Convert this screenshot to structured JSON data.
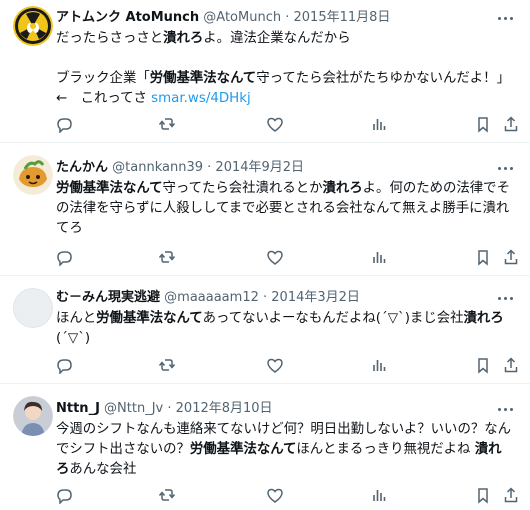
{
  "tweets": [
    {
      "display_name": "アトムンク AtoMunch",
      "handle": "@AtoMunch",
      "separator": "·",
      "date": "2015年11月8日",
      "line1_a": "だったらさっさと",
      "line1_b": "潰れろ",
      "line1_c": "よ。違法企業なんだから",
      "line2_a": "ブラック企業「",
      "line2_b": "労働基準法なんて",
      "line2_c": "守ってたら会社がたちゆかないんだよ！」",
      "line3_a": "←　これってさ ",
      "line3_link": "smar.ws/4DHkj"
    },
    {
      "display_name": "たんかん",
      "handle": "@tannkann39",
      "separator": "·",
      "date": "2014年9月2日",
      "line1_a": "労働基準法なんて",
      "line1_b": "守ってたら会社潰れるとか",
      "line1_c": "潰れろ",
      "line1_d": "よ。何のための法律でそ",
      "line2": "の法律を守らずに人殺ししてまで必要とされる会社なんて無えよ勝手に潰れ",
      "line3": "てろ"
    },
    {
      "display_name": "む－みん現実逃避",
      "handle": "@maaaaam12",
      "separator": "·",
      "date": "2014年3月2日",
      "line1_a": "ほんと",
      "line1_b": "労働基準法なんて",
      "line1_c": "あってないよーなもんだよね(´▽`)まじ会社",
      "line1_d": "潰れろ",
      "line2": "(´▽`)"
    },
    {
      "display_name": "Nttn_J",
      "handle": "@Nttn_Jv",
      "separator": "·",
      "date": "2012年8月10日",
      "line1": "今週のシフトなんも連絡来てないけど何？明日出勤しないよ？いいの？なん",
      "line2_a": "でシフト出さないの？",
      "line2_b": "労働基準法なんて",
      "line2_c": "ほんとまるっきり無視だよね ",
      "line2_d": "潰れ",
      "line3_a": "ろ",
      "line3_b": "あんな会社"
    }
  ],
  "colors": {
    "text": "#0f1419",
    "meta": "#536471",
    "link": "#1d9bf0",
    "divider": "#eff3f4"
  },
  "action_icons": [
    "reply-icon",
    "retweet-icon",
    "like-icon",
    "views-icon",
    "bookmark-icon",
    "share-icon"
  ]
}
